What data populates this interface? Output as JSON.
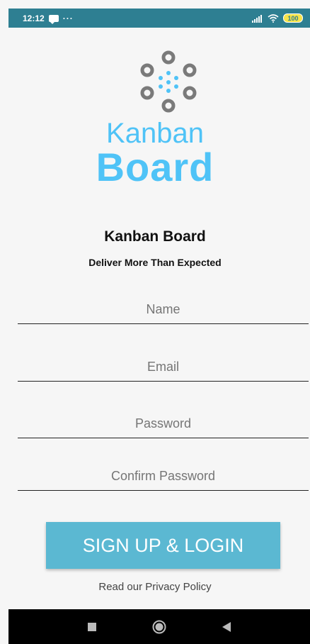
{
  "status_bar": {
    "time": "12:12",
    "more": "···",
    "battery": "100",
    "icons": [
      "message-icon",
      "signal-icon",
      "wifi-icon",
      "battery-icon"
    ]
  },
  "logo": {
    "word1": "Kanban",
    "word2": "Board",
    "color": "#4fc3f7"
  },
  "header": {
    "title": "Kanban Board",
    "tagline": "Deliver More Than Expected"
  },
  "form": {
    "name_placeholder": "Name",
    "email_placeholder": "Email",
    "password_placeholder": "Password",
    "confirm_placeholder": "Confirm Password",
    "name_value": "",
    "email_value": "",
    "password_value": "",
    "confirm_value": ""
  },
  "actions": {
    "signup_label": "SIGN UP & LOGIN",
    "privacy_label": "Read our Privacy Policy"
  },
  "nav": {
    "icons": [
      "recents-icon",
      "home-icon",
      "back-icon"
    ]
  },
  "colors": {
    "status_bar": "#2e7f92",
    "button": "#5bb8d2",
    "brand": "#4fc3f7"
  }
}
